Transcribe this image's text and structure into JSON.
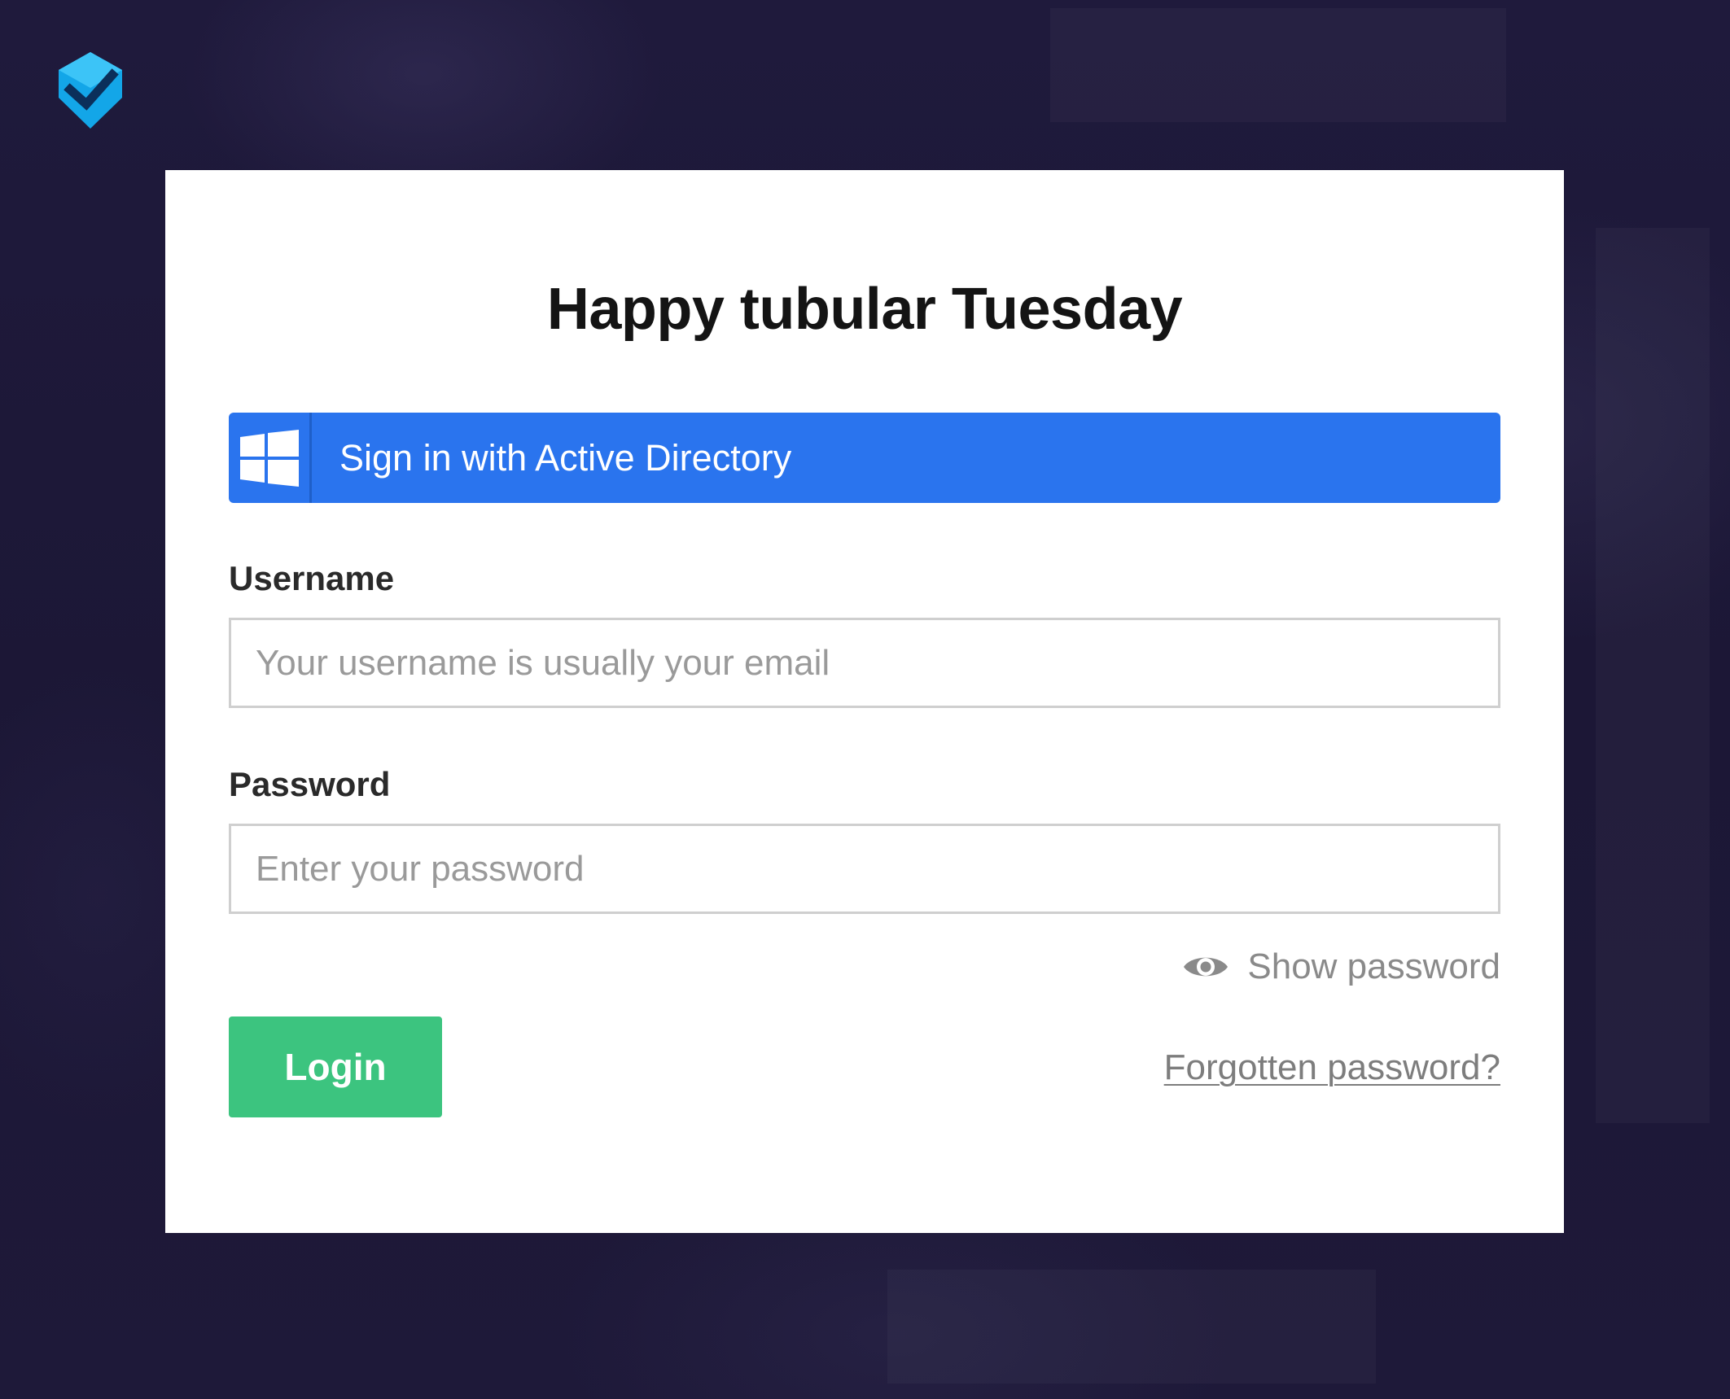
{
  "page": {
    "background_color": "#1d1839"
  },
  "brand": {
    "logo_icon": "shield-check-icon",
    "logo_color": "#13a6e8"
  },
  "login": {
    "title": "Happy tubular Tuesday",
    "sso_button": {
      "label": "Sign in with Active Directory",
      "icon": "windows-icon",
      "color": "#2a74ee"
    },
    "username": {
      "label": "Username",
      "value": "",
      "placeholder": "Your username is usually your email"
    },
    "password": {
      "label": "Password",
      "value": "",
      "placeholder": "Enter your password"
    },
    "show_password": {
      "label": "Show password",
      "icon": "eye-icon"
    },
    "login_button": {
      "label": "Login",
      "color": "#3cc47f"
    },
    "forgot_password": {
      "label": "Forgotten password?"
    }
  }
}
